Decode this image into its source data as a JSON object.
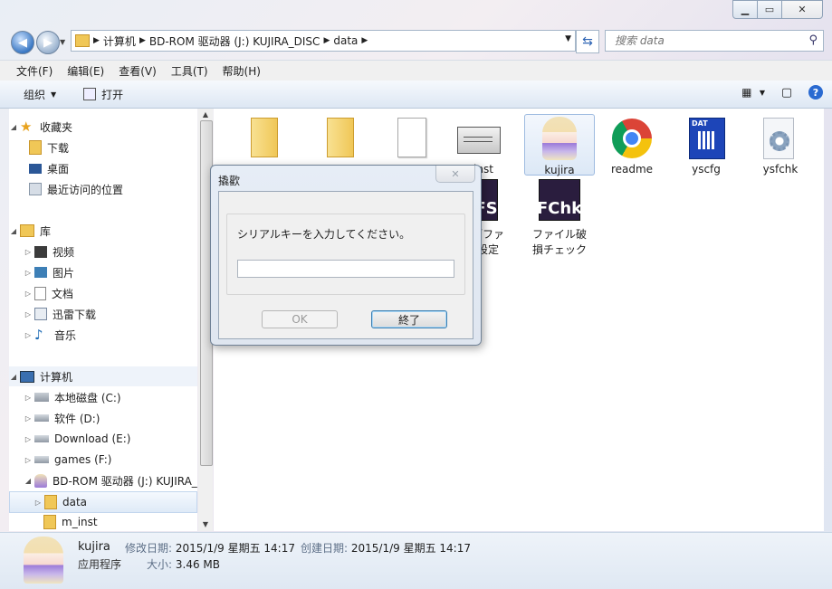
{
  "navigation": {
    "path": [
      "计算机",
      "BD-ROM 驱动器 (J:) KUJIRA_DISC",
      "data"
    ],
    "search_placeholder": "搜索 data"
  },
  "menu": [
    "文件(F)",
    "编辑(E)",
    "查看(V)",
    "工具(T)",
    "帮助(H)"
  ],
  "toolbar": {
    "organize": "组织",
    "open": "打开"
  },
  "sidebar": {
    "favorites": {
      "label": "收藏夹",
      "items": [
        "下载",
        "桌面",
        "最近访问的位置"
      ]
    },
    "libraries": {
      "label": "库",
      "items": [
        "视频",
        "图片",
        "文档",
        "迅雷下载",
        "音乐"
      ]
    },
    "computer": {
      "label": "计算机",
      "items": [
        "本地磁盘 (C:)",
        "软件 (D:)",
        "Download (E:)",
        "games (F:)",
        "BD-ROM 驱动器 (J:) KUJIRA_",
        "data",
        "m_inst"
      ]
    }
  },
  "files_row1": [
    "kujira",
    "readme",
    "yscfg",
    "ysfchk"
  ],
  "files_partial": {
    "inst": "inst",
    "fs_line1": "ブファ",
    "fs_line2": "設定"
  },
  "files_row2": {
    "fchk_line1": "ファイル破",
    "fchk_line2": "損チェック",
    "fchk_glyph": "FChk",
    "fs_glyph": "FS"
  },
  "dat_badge": "DAT",
  "dialog": {
    "title": "撬歡",
    "message": "シリアルキーを入力してください。",
    "input_value": "",
    "ok": "OK",
    "end": "終了"
  },
  "details": {
    "name": "kujira",
    "type": "应用程序",
    "modified_label": "修改日期:",
    "modified": "2015/1/9 星期五 14:17",
    "created_label": "创建日期:",
    "created": "2015/1/9 星期五 14:17",
    "size_label": "大小:",
    "size": "3.46 MB"
  }
}
